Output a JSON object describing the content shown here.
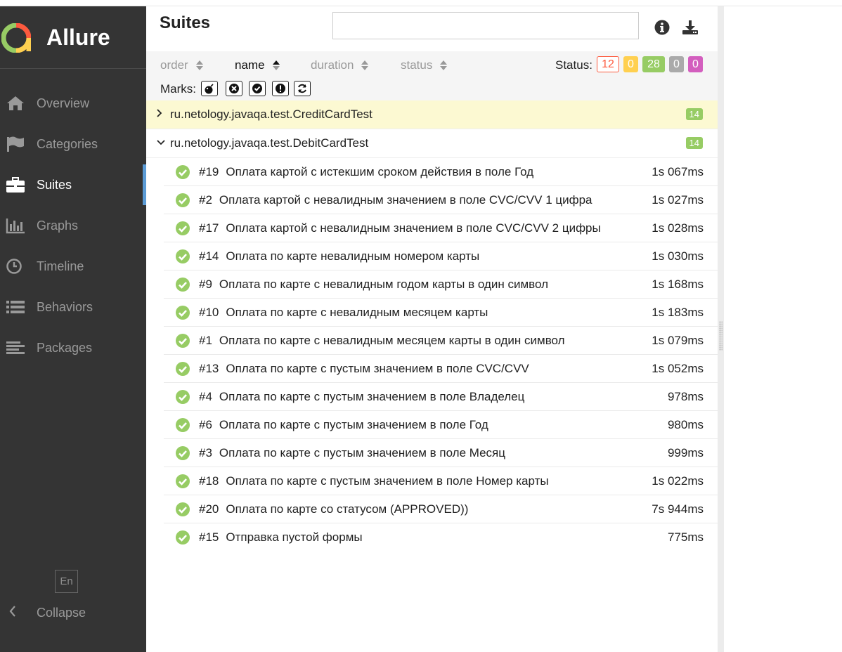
{
  "app": {
    "title": "Allure",
    "brand_colors": [
      "#97cc64",
      "#fd5a3e",
      "#ffd050",
      "#4a90d9"
    ]
  },
  "sidebar": {
    "items": [
      {
        "label": "Overview",
        "icon": "home-icon"
      },
      {
        "label": "Categories",
        "icon": "flag-icon"
      },
      {
        "label": "Suites",
        "icon": "briefcase-icon",
        "active": true
      },
      {
        "label": "Graphs",
        "icon": "bar-chart-icon"
      },
      {
        "label": "Timeline",
        "icon": "clock-icon"
      },
      {
        "label": "Behaviors",
        "icon": "list-icon"
      },
      {
        "label": "Packages",
        "icon": "align-left-icon"
      }
    ],
    "language": "En",
    "collapse_label": "Collapse"
  },
  "header": {
    "title": "Suites",
    "search_value": ""
  },
  "toolbar": {
    "sort": [
      {
        "label": "order",
        "active": false
      },
      {
        "label": "name",
        "active": true
      },
      {
        "label": "duration",
        "active": false
      },
      {
        "label": "status",
        "active": false
      }
    ],
    "status_label": "Status:",
    "status_counts": {
      "failed": "12",
      "broken": "0",
      "passed": "28",
      "skipped": "0",
      "unknown": "0"
    },
    "status_colors": {
      "failed": "#fd5a3e",
      "broken": "#ffd050",
      "passed": "#97cc64",
      "skipped": "#aaaaaa",
      "unknown": "#d35ebe"
    },
    "marks_label": "Marks:",
    "marks": [
      "bomb-icon",
      "times-circle-icon",
      "check-circle-icon",
      "exclamation-circle-icon",
      "refresh-icon"
    ]
  },
  "groups": [
    {
      "name": "ru.netology.javaqa.test.CreditCardTest",
      "count": "14",
      "expanded": false
    },
    {
      "name": "ru.netology.javaqa.test.DebitCardTest",
      "count": "14",
      "expanded": true
    }
  ],
  "tests": [
    {
      "num": "#19",
      "name": "Оплата картой с истекшим сроком действия в поле Год",
      "duration": "1s 067ms"
    },
    {
      "num": "#2",
      "name": "Оплата картой с невалидным значением в поле CVC/CVV 1 цифра",
      "duration": "1s 027ms"
    },
    {
      "num": "#17",
      "name": "Оплата картой с невалидным значением в поле CVC/CVV 2 цифры",
      "duration": "1s 028ms"
    },
    {
      "num": "#14",
      "name": "Оплата по карте невалидным номером карты",
      "duration": "1s 030ms"
    },
    {
      "num": "#9",
      "name": "Оплата по карте с невалидным годом карты в один символ",
      "duration": "1s 168ms"
    },
    {
      "num": "#10",
      "name": "Оплата по карте с невалидным месяцем карты",
      "duration": "1s 183ms"
    },
    {
      "num": "#1",
      "name": "Оплата по карте с невалидным месяцем карты в один символ",
      "duration": "1s 079ms"
    },
    {
      "num": "#13",
      "name": "Оплата по карте с пустым значением в поле CVC/CVV",
      "duration": "1s 052ms"
    },
    {
      "num": "#4",
      "name": "Оплата по карте с пустым значением в поле Владелец",
      "duration": "978ms"
    },
    {
      "num": "#6",
      "name": "Оплата по карте с пустым значением в поле Год",
      "duration": "980ms"
    },
    {
      "num": "#3",
      "name": "Оплата по карте с пустым значением в поле Месяц",
      "duration": "999ms"
    },
    {
      "num": "#18",
      "name": "Оплата по карте с пустым значением в поле Номер карты",
      "duration": "1s 022ms"
    },
    {
      "num": "#20",
      "name": "Оплата по карте со статусом (APPROVED))",
      "duration": "7s 944ms"
    },
    {
      "num": "#15",
      "name": "Отправка пустой формы",
      "duration": "775ms"
    }
  ]
}
